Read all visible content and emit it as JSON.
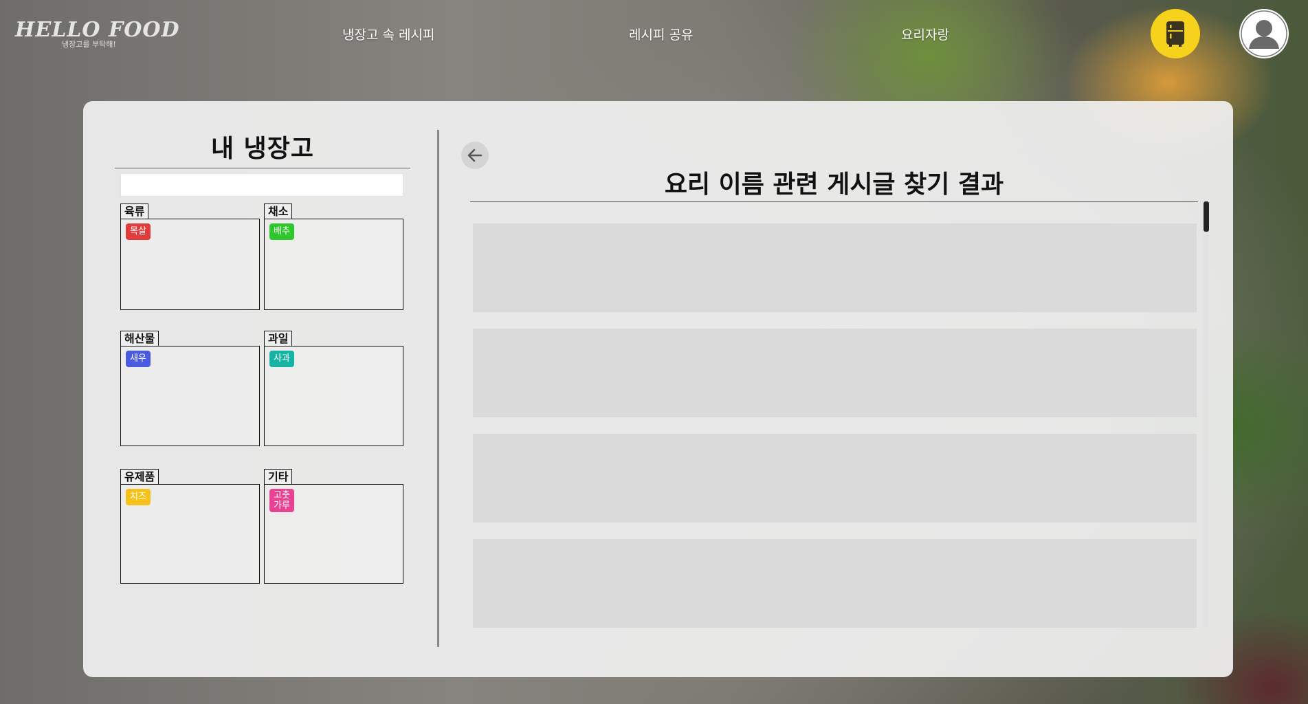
{
  "header": {
    "logo_main": "HELLO FOOD",
    "logo_sub": "냉장고를 부탁해!",
    "nav": [
      {
        "label": "냉장고 속 레시피"
      },
      {
        "label": "레시피 공유"
      },
      {
        "label": "요리자랑"
      }
    ],
    "fridge_icon": "fridge-icon",
    "avatar_icon": "user-icon"
  },
  "fridge": {
    "title": "내 냉장고",
    "search": {
      "value": "",
      "placeholder": ""
    },
    "categories": [
      {
        "name": "육류",
        "items": [
          {
            "label": "목살",
            "color": "#e03c3c"
          }
        ]
      },
      {
        "name": "채소",
        "items": [
          {
            "label": "배추",
            "color": "#2ec72e"
          }
        ]
      },
      {
        "name": "해산물",
        "items": [
          {
            "label": "새우",
            "color": "#4a5be0"
          }
        ]
      },
      {
        "name": "과일",
        "items": [
          {
            "label": "사과",
            "color": "#17b3a3"
          }
        ]
      },
      {
        "name": "유제품",
        "items": [
          {
            "label": "치즈",
            "color": "#f5c21b"
          }
        ]
      },
      {
        "name": "기타",
        "items": [
          {
            "label": "고춧\n가루",
            "color": "#e84393"
          }
        ]
      }
    ]
  },
  "results": {
    "title": "요리 이름 관련 게시글 찾기 결과",
    "back_icon": "arrow-left-icon",
    "cards": [
      {},
      {},
      {},
      {}
    ]
  },
  "colors": {
    "accent_yellow": "#f7d21c",
    "card_gray": "#dadada"
  }
}
